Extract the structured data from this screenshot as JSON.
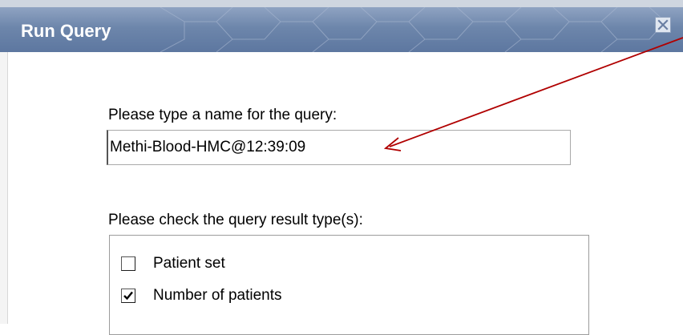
{
  "dialog": {
    "title": "Run Query",
    "name_prompt": "Please type a name for the query:",
    "name_value": "Methi-Blood-HMC@12:39:09",
    "result_type_prompt": "Please check the query result type(s):",
    "result_types": [
      {
        "label": "Patient set",
        "checked": false
      },
      {
        "label": "Number of patients",
        "checked": true
      }
    ]
  },
  "colors": {
    "titlebar": "#6d86ab",
    "annotation_arrow": "#b00000"
  },
  "icons": {
    "close": "close-x-icon"
  }
}
